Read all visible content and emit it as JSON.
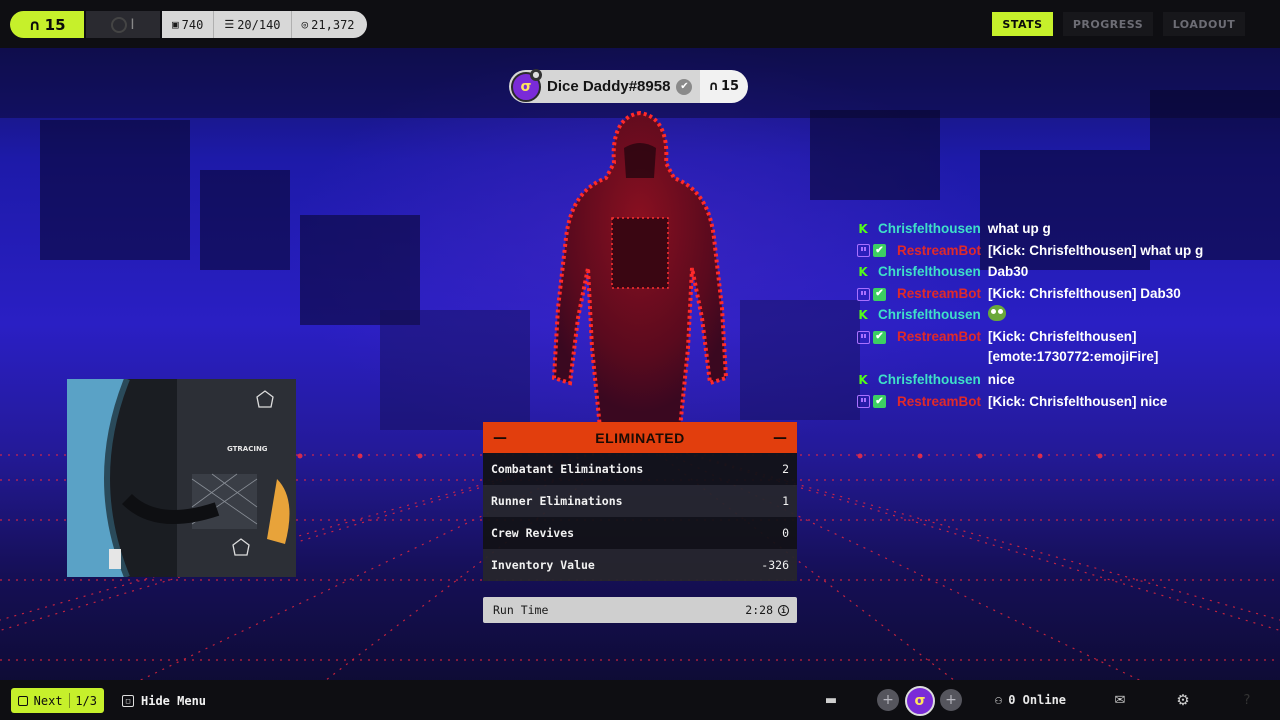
{
  "top_bar": {
    "level": "15",
    "mid_value": "I",
    "currencies": [
      {
        "icon": "crate-icon",
        "value": "740"
      },
      {
        "icon": "stash-icon",
        "value": "20/140"
      },
      {
        "icon": "coin-icon",
        "value": "21,372"
      }
    ],
    "tabs": [
      {
        "label": "STATS",
        "active": true
      },
      {
        "label": "PROGRESS",
        "active": false
      },
      {
        "label": "LOADOUT",
        "active": false
      }
    ]
  },
  "player": {
    "name": "Dice Daddy#8958",
    "level": "15"
  },
  "chat": [
    {
      "kind": "user",
      "user": "Chrisfelthousen",
      "message": "what up g"
    },
    {
      "kind": "bot",
      "user": "RestreamBot",
      "message": "[Kick: Chrisfelthousen] what up g"
    },
    {
      "kind": "user",
      "user": "Chrisfelthousen",
      "message": "Dab30"
    },
    {
      "kind": "bot",
      "user": "RestreamBot",
      "message": "[Kick: Chrisfelthousen] Dab30"
    },
    {
      "kind": "user",
      "user": "Chrisfelthousen",
      "message": "",
      "emote": true
    },
    {
      "kind": "bot",
      "user": "RestreamBot",
      "message": "[Kick: Chrisfelthousen]",
      "message2": "[emote:1730772:emojiFire]"
    },
    {
      "kind": "user",
      "user": "Chrisfelthousen",
      "message": "nice"
    },
    {
      "kind": "bot",
      "user": "RestreamBot",
      "message": "[Kick: Chrisfelthousen] nice"
    }
  ],
  "results": {
    "title": "ELIMINATED",
    "rows": [
      {
        "label": "Combatant Eliminations",
        "value": "2"
      },
      {
        "label": "Runner Eliminations",
        "value": "1"
      },
      {
        "label": "Crew Revives",
        "value": "0"
      },
      {
        "label": "Inventory Value",
        "value": "-326"
      }
    ],
    "run_time_label": "Run Time",
    "run_time_value": "2:28"
  },
  "webcam": {
    "chair_brand": "GTRACING"
  },
  "bottom_bar": {
    "next_label": "Next",
    "next_page": "1/3",
    "hide_menu_label": "Hide Menu",
    "online_label": "0 Online"
  },
  "colors": {
    "accent": "#c6f02b",
    "eliminated": "#e23e0d",
    "chat_user": "#3fe0c8",
    "chat_bot": "#e02a2a"
  }
}
